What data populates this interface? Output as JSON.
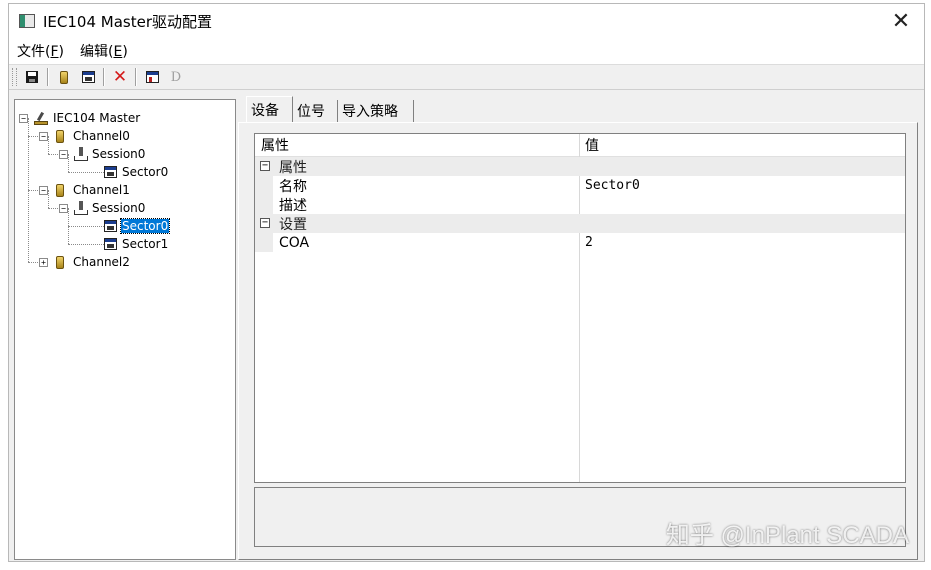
{
  "window": {
    "title": "IEC104 Master驱动配置",
    "close_glyph": "✕"
  },
  "menu": [
    {
      "label": "文件(",
      "accel": "F",
      "tail": ")"
    },
    {
      "label": "编辑(",
      "accel": "E",
      "tail": ")"
    }
  ],
  "toolbar": {
    "items": [
      "save-icon",
      "channel-icon",
      "sector-icon",
      "delete-icon",
      "export-icon",
      "d-icon"
    ],
    "d_label": "D",
    "delete_glyph": "✕"
  },
  "tree": {
    "root": "IEC104 Master",
    "channel0": "Channel0",
    "session0a": "Session0",
    "sector0a": "Sector0",
    "channel1": "Channel1",
    "session0b": "Session0",
    "sector0b": "Sector0",
    "sector1b": "Sector1",
    "channel2": "Channel2",
    "expander_open": "−",
    "expander_closed": "+"
  },
  "tabs": [
    "设备",
    "位号",
    "导入策略"
  ],
  "grid": {
    "col_property": "属性",
    "col_value": "值",
    "cat1": "属性",
    "row_name_label": "名称",
    "row_name_value": "Sector0",
    "row_desc_label": "描述",
    "row_desc_value": "",
    "cat2": "设置",
    "row_coa_label": "COA",
    "row_coa_value": "2",
    "collapse_glyph": "−"
  },
  "watermark": "知乎 @InPlant SCADA"
}
